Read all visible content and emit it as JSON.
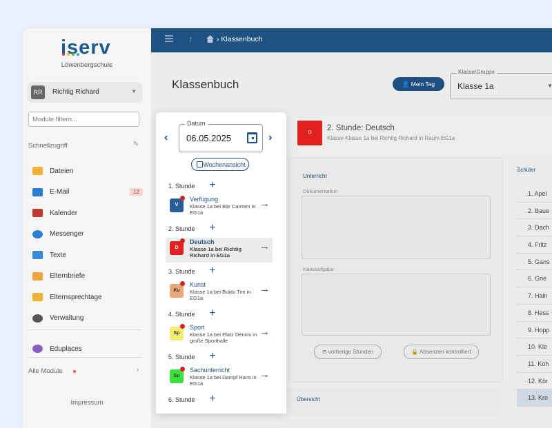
{
  "colors": {
    "brand": "#1e5283",
    "accent": "#1e4f7e",
    "active_lesson": "#e32020"
  },
  "sidebar": {
    "logo": "iserv",
    "school": "Löwenbergschule",
    "user": {
      "initials": "RR",
      "name": "Richtig Richard"
    },
    "module_filter_placeholder": "Module filtern...",
    "quick_access": "Schnellzugriff",
    "items": [
      {
        "label": "Dateien",
        "icon": "folder-icon",
        "color": "#f0b230"
      },
      {
        "label": "E-Mail",
        "icon": "mail-icon",
        "color": "#2a7fd4",
        "badge": "12"
      },
      {
        "label": "Kalender",
        "icon": "calendar-icon",
        "color": "#c0392b"
      },
      {
        "label": "Messenger",
        "icon": "chat-icon",
        "color": "#2a7fd4"
      },
      {
        "label": "Texte",
        "icon": "text-icon",
        "color": "#3a88d8"
      },
      {
        "label": "Elternbriefe",
        "icon": "letter-icon",
        "color": "#f2a33a"
      },
      {
        "label": "Elternsprechtage",
        "icon": "people-icon",
        "color": "#f0b230"
      },
      {
        "label": "Verwaltung",
        "icon": "gear-icon",
        "color": "#555555"
      },
      {
        "label": "Eduplaces",
        "icon": "eduplaces-icon",
        "color": "#8a5fc4"
      }
    ],
    "all_modules": "Alle Module",
    "impressum": "Impressum"
  },
  "topbar": {
    "breadcrumb": "Klassenbuch"
  },
  "main": {
    "title": "Klassenbuch",
    "my_day_button": "Mein Tag",
    "group_label": "Klasse/Gruppe",
    "group_value": "Klasse 1a"
  },
  "day": {
    "date_label": "Datum",
    "date_value": "06.05.2025",
    "week_view": "Wochenansicht",
    "lessons": [
      {
        "label": "1. Stunde",
        "entry": {
          "abbr": "V",
          "title": "Verfügung",
          "sub": "Klasse 1a bei Bär Carmen in EG1a",
          "color": "#2a5d95",
          "text_color": "#ffffff"
        }
      },
      {
        "label": "2. Stunde",
        "entry": {
          "abbr": "D",
          "title": "Deutsch",
          "sub": "Klasse 1a bei Richtig Richard in EG1a",
          "color": "#e32020",
          "text_color": "#ffffff",
          "active": true
        }
      },
      {
        "label": "3. Stunde",
        "entry": {
          "abbr": "Ku",
          "title": "Kunst",
          "sub": "Klasse 1a bei Buktu Tim in EG1a",
          "color": "#e8a878",
          "text_color": "#333333"
        }
      },
      {
        "label": "4. Stunde",
        "entry": {
          "abbr": "Sp",
          "title": "Sport",
          "sub": "Klasse 1a bei Platz Dennis in große Sporthalle",
          "color": "#f2ec70",
          "text_color": "#333333"
        }
      },
      {
        "label": "5. Stunde",
        "entry": {
          "abbr": "Su",
          "title": "Sachunterricht",
          "sub": "Klasse 1a bei Dampf Hans in EG1a",
          "color": "#3ce23c",
          "text_color": "#333333"
        }
      },
      {
        "label": "6. Stunde"
      }
    ]
  },
  "lesson_detail": {
    "title": "2. Stunde: Deutsch",
    "subtitle": "Klasse Klasse 1a bei Richtig Richard in Raum EG1a",
    "section_title": "Unterricht",
    "documentation_label": "Dokumentation",
    "homework_label": "Hausaufgabe",
    "prev_button": "vorherige Stunden",
    "absences_button": "Absenzen kontrolliert",
    "overview_title": "Übersicht"
  },
  "students": {
    "title": "Schüler",
    "list": [
      "1. Apel",
      "2. Baue",
      "3. Dach",
      "4. Fritz",
      "5. Gans",
      "6. Grie",
      "7. Hain",
      "8. Hess",
      "9. Hopp",
      "10. Kle",
      "11. Köh",
      "12. Kör",
      "13. Kro"
    ],
    "selected_index": 12
  }
}
